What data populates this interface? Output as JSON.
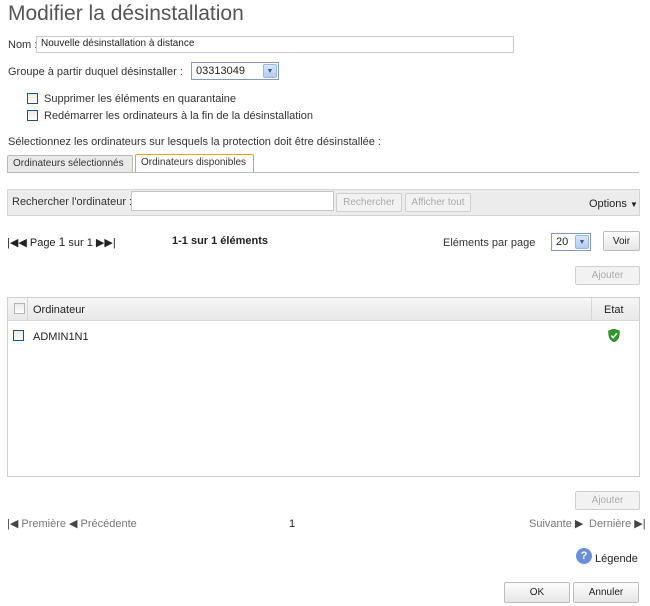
{
  "page": {
    "title": "Modifier la désinstallation"
  },
  "form": {
    "name_label": "Nom :",
    "name_value": "Nouvelle désinstallation à distance",
    "group_label": "Groupe à partir duquel désinstaller :",
    "group_value": "03313049",
    "chk_quarantine": "Supprimer les éléments en quarantaine",
    "chk_restart": "Redémarrer les ordinateurs à la fin de la désinstallation",
    "select_computers_label": "Sélectionnez les ordinateurs sur lesquels la protection doit être désinstallée :"
  },
  "tabs": [
    {
      "label": "Ordinateurs sélectionnés",
      "active": false
    },
    {
      "label": "Ordinateurs disponibles",
      "active": true
    }
  ],
  "search": {
    "label": "Rechercher l'ordinateur :",
    "value": "",
    "search_button": "Rechercher",
    "show_all_button": "Afficher tout",
    "options_label": "Options"
  },
  "pager_top": {
    "page_word": "Page",
    "page_current": "1",
    "of_word": "sur",
    "page_total": "1",
    "summary": "1-1 sur 1 éléments",
    "per_page_label": "Eléments par page",
    "per_page_value": "20",
    "view_button": "Voir"
  },
  "add_button": "Ajouter",
  "table": {
    "columns": [
      "Ordinateur",
      "Etat"
    ],
    "rows": [
      {
        "computer": "ADMIN1N1",
        "state_icon": "green-shield-check-icon"
      }
    ]
  },
  "pager_bottom": {
    "first": "Première",
    "previous": "Précédente",
    "page": "1",
    "next": "Suivante",
    "last": "Dernière"
  },
  "legend_label": "Légende",
  "footer": {
    "ok": "OK",
    "cancel": "Annuler"
  },
  "colors": {
    "tab_active_border": "#f0a020",
    "status_ok": "#2e9a2e"
  }
}
